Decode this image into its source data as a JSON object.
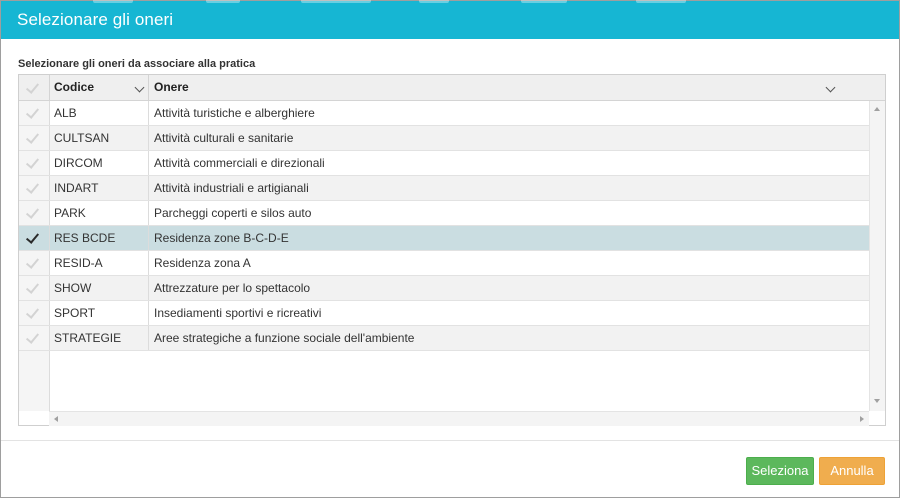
{
  "dialog": {
    "title": "Selezionare gli oneri",
    "caption": "Selezionare gli oneri da associare alla pratica"
  },
  "grid": {
    "columns": {
      "codice": "Codice",
      "onere": "Onere"
    },
    "rows": [
      {
        "codice": "ALB",
        "onere": "Attività turistiche e alberghiere",
        "selected": false
      },
      {
        "codice": "CULTSAN",
        "onere": "Attività culturali e sanitarie",
        "selected": false
      },
      {
        "codice": "DIRCOM",
        "onere": "Attività commerciali e direzionali",
        "selected": false
      },
      {
        "codice": "INDART",
        "onere": "Attività industriali e artigianali",
        "selected": false
      },
      {
        "codice": "PARK",
        "onere": "Parcheggi coperti e silos auto",
        "selected": false
      },
      {
        "codice": "RES BCDE",
        "onere": "Residenza zone B-C-D-E",
        "selected": true
      },
      {
        "codice": "RESID-A",
        "onere": "Residenza zona A",
        "selected": false
      },
      {
        "codice": "SHOW",
        "onere": "Attrezzature per lo spettacolo",
        "selected": false
      },
      {
        "codice": "SPORT",
        "onere": "Insediamenti sportivi e ricreativi",
        "selected": false
      },
      {
        "codice": "STRATEGIE",
        "onere": "Aree strategiche a funzione sociale dell'ambiente",
        "selected": false
      }
    ]
  },
  "buttons": {
    "select": "Seleziona",
    "cancel": "Annulla"
  },
  "colors": {
    "titlebar": "#16b6d3",
    "selected_row": "#cadde1",
    "select_button": "#5cb85c",
    "cancel_button": "#f0ad4e"
  },
  "icons": {
    "header_checkbox": "checkmark-icon",
    "row_checkbox": "checkmark-icon",
    "sort": "chevron-down-icon"
  }
}
